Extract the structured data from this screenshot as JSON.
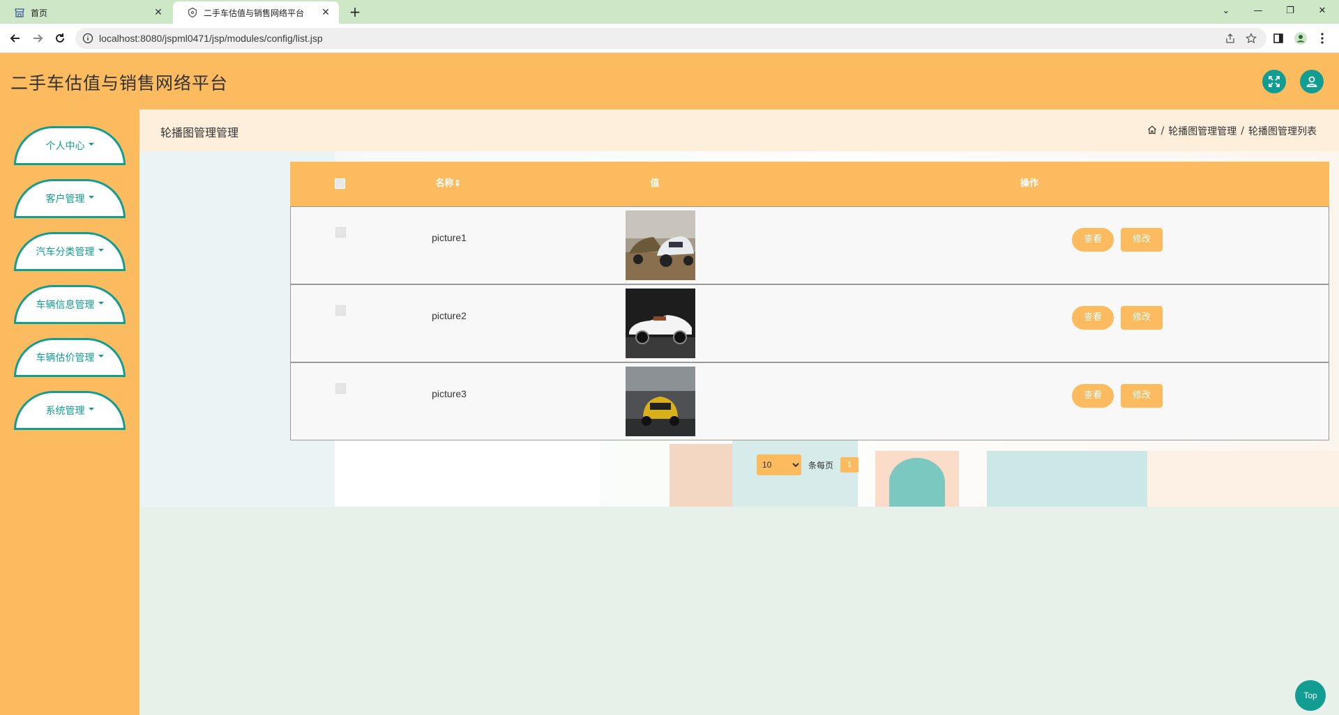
{
  "browser": {
    "tabs": [
      {
        "title": "首页"
      },
      {
        "title": "二手车估值与销售网络平台"
      }
    ],
    "url": "localhost:8080/jspml0471/jsp/modules/config/list.jsp"
  },
  "header": {
    "title": "二手车估值与销售网络平台"
  },
  "sidebar": {
    "items": [
      {
        "label": "个人中心"
      },
      {
        "label": "客户管理"
      },
      {
        "label": "汽车分类管理"
      },
      {
        "label": "车辆信息管理"
      },
      {
        "label": "车辆估价管理"
      },
      {
        "label": "系统管理"
      }
    ]
  },
  "breadcrumb": {
    "title": "轮播图管理管理",
    "path1": "轮播图管理管理",
    "sep": "/",
    "path2": "轮播图管理列表"
  },
  "table": {
    "headers": {
      "name": "名称",
      "value": "值",
      "actions": "操作"
    },
    "rows": [
      {
        "name": "picture1",
        "view": "查看",
        "edit": "修改"
      },
      {
        "name": "picture2",
        "view": "查看",
        "edit": "修改"
      },
      {
        "name": "picture3",
        "view": "查看",
        "edit": "修改"
      }
    ]
  },
  "pagination": {
    "page_size": "10",
    "per_page_label": "条每页",
    "current_page": "1"
  },
  "top_button": "Top",
  "colors": {
    "accent": "#fbbb5e",
    "teal": "#119d91",
    "tab_bar": "#cde7c7"
  }
}
